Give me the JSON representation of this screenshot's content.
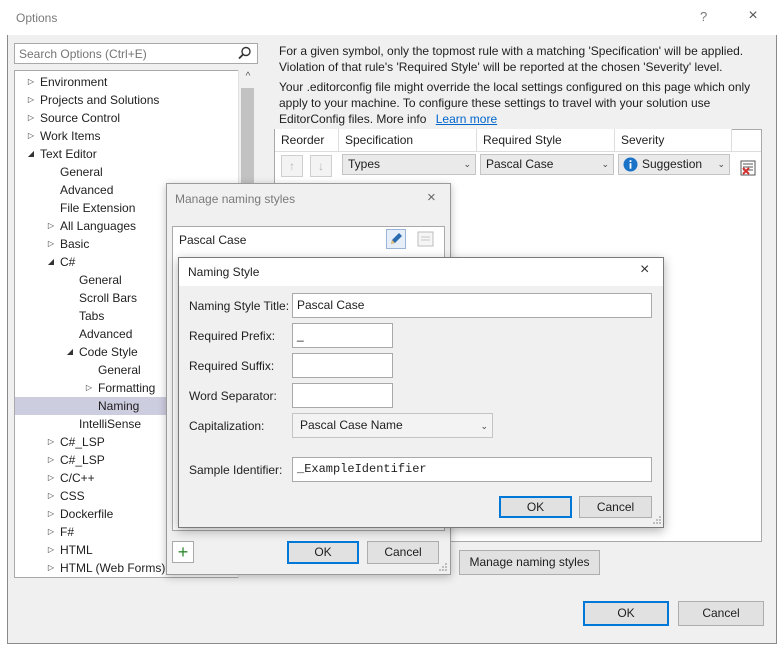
{
  "window": {
    "title": "Options",
    "help_glyph": "?",
    "close_glyph": "×"
  },
  "search": {
    "placeholder": "Search Options (Ctrl+E)"
  },
  "tree": {
    "items": [
      {
        "label": "Environment",
        "expander": "▷"
      },
      {
        "label": "Projects and Solutions",
        "expander": "▷"
      },
      {
        "label": "Source Control",
        "expander": "▷"
      },
      {
        "label": "Work Items",
        "expander": "▷"
      },
      {
        "label": "Text Editor",
        "expander": "◢"
      },
      {
        "label": "General",
        "expander": ""
      },
      {
        "label": "Advanced",
        "expander": ""
      },
      {
        "label": "File Extension",
        "expander": ""
      },
      {
        "label": "All Languages",
        "expander": "▷"
      },
      {
        "label": "Basic",
        "expander": "▷"
      },
      {
        "label": "C#",
        "expander": "◢"
      },
      {
        "label": "General",
        "expander": ""
      },
      {
        "label": "Scroll Bars",
        "expander": ""
      },
      {
        "label": "Tabs",
        "expander": ""
      },
      {
        "label": "Advanced",
        "expander": ""
      },
      {
        "label": "Code Style",
        "expander": "◢"
      },
      {
        "label": "General",
        "expander": ""
      },
      {
        "label": "Formatting",
        "expander": "▷"
      },
      {
        "label": "Naming",
        "expander": ""
      },
      {
        "label": "IntelliSense",
        "expander": ""
      },
      {
        "label": "C#_LSP",
        "expander": "▷"
      },
      {
        "label": "C#_LSP",
        "expander": "▷"
      },
      {
        "label": "C/C++",
        "expander": "▷"
      },
      {
        "label": "CSS",
        "expander": "▷"
      },
      {
        "label": "Dockerfile",
        "expander": "▷"
      },
      {
        "label": "F#",
        "expander": "▷"
      },
      {
        "label": "HTML",
        "expander": "▷"
      },
      {
        "label": "HTML (Web Forms)",
        "expander": "▷"
      }
    ],
    "scroll_up_glyph": "^"
  },
  "info": {
    "line1": "For a given symbol, only the topmost rule with a matching 'Specification' will be applied.",
    "line2": "Violation of that rule's 'Required Style' will be reported at the chosen 'Severity' level.",
    "line3": "Your .editorconfig file might override the local settings configured on this page which only",
    "line4": "apply to your machine. To configure these settings to travel with your solution use",
    "line5": "EditorConfig files. More info",
    "learn_more": "Learn more"
  },
  "grid": {
    "headers": [
      "Reorder",
      "Specification",
      "Required Style",
      "Severity"
    ],
    "row": {
      "up_glyph": "↑",
      "down_glyph": "↓",
      "specification": "Types",
      "required_style": "Pascal Case",
      "severity": "Suggestion"
    }
  },
  "manage_button": "Manage naming styles",
  "options_ok": "OK",
  "options_cancel": "Cancel",
  "manage_dialog": {
    "title": "Manage naming styles",
    "close_glyph": "×",
    "items": [
      "Pascal Case"
    ],
    "add_glyph": "+",
    "ok": "OK",
    "cancel": "Cancel"
  },
  "naming_dialog": {
    "title": "Naming Style",
    "close_glyph": "×",
    "title_label": "Naming Style Title:",
    "title_value": "Pascal Case",
    "prefix_label": "Required Prefix:",
    "prefix_value": "_",
    "suffix_label": "Required Suffix:",
    "suffix_value": "",
    "separator_label": "Word Separator:",
    "separator_value": "",
    "capitalization_label": "Capitalization:",
    "capitalization_value": "Pascal Case Name",
    "sample_label": "Sample Identifier:",
    "sample_value": "_ExampleIdentifier",
    "ok": "OK",
    "cancel": "Cancel"
  },
  "colors": {
    "selection": "#cdcde0",
    "accent": "#0078d7",
    "link": "#0066cc",
    "info_icon": "#1a73c7",
    "add_icon": "#2e8b2e"
  }
}
